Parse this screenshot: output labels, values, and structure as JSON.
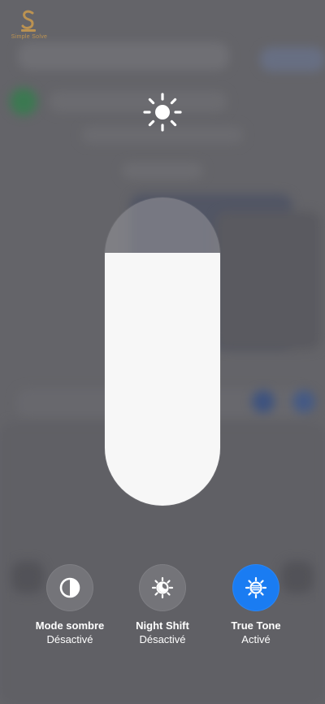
{
  "watermark": {
    "text": "Simple Solve"
  },
  "brightness": {
    "level": 0.82
  },
  "controls": [
    {
      "label": "Mode sombre",
      "state": "Désactivé",
      "icon": "dark-mode-icon",
      "active": false
    },
    {
      "label": "Night Shift",
      "state": "Désactivé",
      "icon": "night-shift-icon",
      "active": false
    },
    {
      "label": "True Tone",
      "state": "Activé",
      "icon": "true-tone-icon",
      "active": true
    }
  ],
  "colors": {
    "accent": "#1a7cf2",
    "fill": "#f7f7f7"
  }
}
